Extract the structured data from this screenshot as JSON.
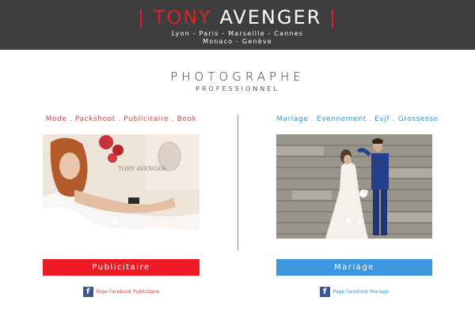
{
  "header": {
    "bar_left": "|",
    "first_name": "TONY",
    "last_name": "AVENGER",
    "bar_right": "|",
    "cities_line1": "Lyon - Paris - Marseille - Cannes",
    "cities_line2": "Monaco - Genève",
    "background": "#3e3e3e",
    "accent": "#e11f26"
  },
  "hero": {
    "title": "PHOTOGRAPHE",
    "subtitle": "PROFESSIONNEL"
  },
  "left": {
    "categories": "Mode . Packshoot . Publicitaire . Book",
    "image_watermark": "TONY AVENGER",
    "button_label": "Publicitaire",
    "button_color": "#ed1c24",
    "facebook_link": "Page Facebook Publicitaire",
    "facebook_icon": "facebook-icon"
  },
  "right": {
    "categories": "Mariage . Evennement . Evjf . Grossesse",
    "button_label": "Mariage",
    "button_color": "#3d96e0",
    "facebook_link": "Page Facebook Mariage",
    "facebook_icon": "facebook-icon"
  }
}
